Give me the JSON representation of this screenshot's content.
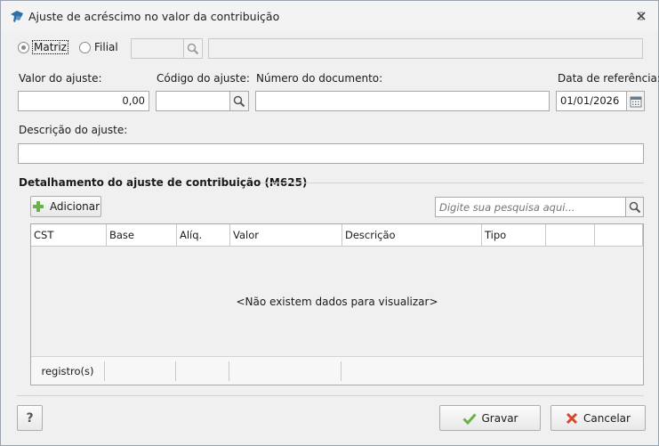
{
  "window": {
    "title": "Ajuste de acréscimo no valor da contribuição"
  },
  "branch": {
    "options": [
      {
        "label": "Matriz",
        "checked": true
      },
      {
        "label": "Filial",
        "checked": false
      }
    ],
    "code_value": "",
    "name_value": ""
  },
  "fields": {
    "valor_label": "Valor do ajuste:",
    "valor_value": "0,00",
    "codigo_label": "Código do ajuste:",
    "codigo_value": "",
    "numero_label": "Número do documento:",
    "numero_value": "",
    "data_label": "Data de referência:",
    "data_value": "01/01/2026",
    "descricao_label": "Descrição do ajuste:",
    "descricao_value": ""
  },
  "detail": {
    "section_title": "Detalhamento do ajuste de contribuição (M625)",
    "add_label": "Adicionar",
    "search_placeholder": "Digite sua pesquisa aqui...",
    "columns": [
      "CST",
      "Base",
      "Alíq.",
      "Valor",
      "Descrição",
      "Tipo",
      "",
      ""
    ],
    "empty_message": "<Não existem dados para visualizar>",
    "footer_label": "registro(s)"
  },
  "footer": {
    "help_label": "?",
    "save_label": "Gravar",
    "cancel_label": "Cancelar"
  },
  "colors": {
    "accent_green": "#6ab04c",
    "cancel_red": "#d9472b"
  }
}
